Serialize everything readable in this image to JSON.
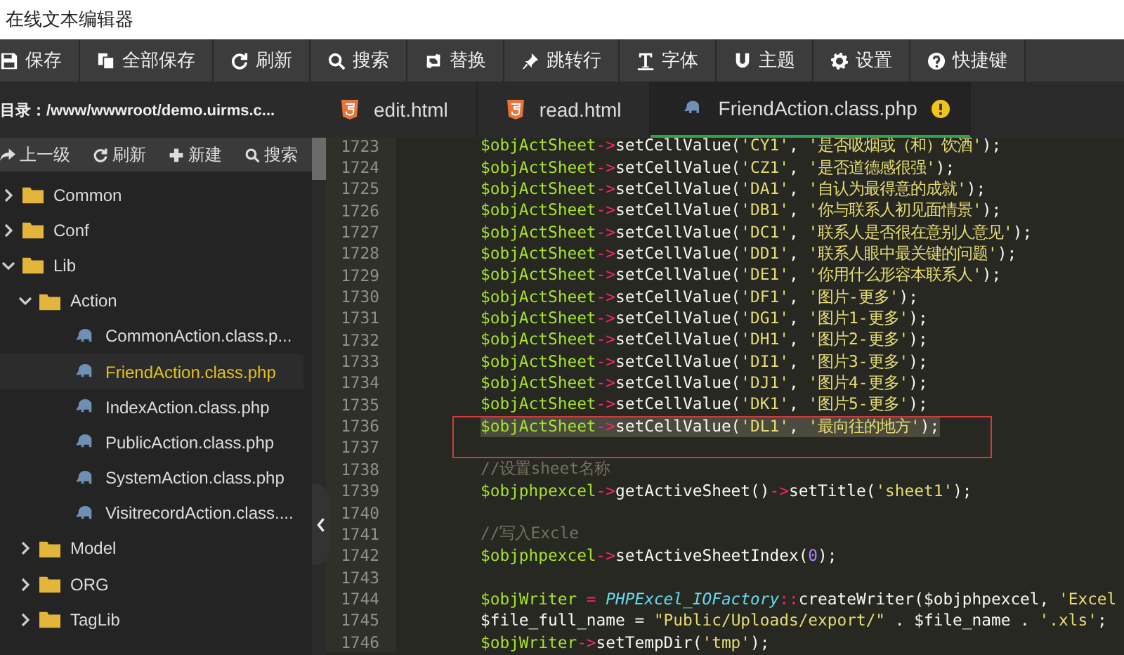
{
  "window": {
    "title": "在线文本编辑器"
  },
  "toolbar": [
    {
      "label": "保存"
    },
    {
      "label": "全部保存"
    },
    {
      "label": "刷新"
    },
    {
      "label": "搜索"
    },
    {
      "label": "替换"
    },
    {
      "label": "跳转行"
    },
    {
      "label": "字体"
    },
    {
      "label": "主题"
    },
    {
      "label": "设置"
    },
    {
      "label": "快捷键"
    }
  ],
  "sidebar": {
    "path": "目录：/www/wwwroot/demo.uirms.c...",
    "actions": [
      {
        "label": "上一级"
      },
      {
        "label": "刷新"
      },
      {
        "label": "新建"
      },
      {
        "label": "搜索"
      }
    ],
    "tree": [
      {
        "name": "Common",
        "kind": "folder",
        "expanded": false
      },
      {
        "name": "Conf",
        "kind": "folder",
        "expanded": false
      },
      {
        "name": "Lib",
        "kind": "folder",
        "expanded": true,
        "children": [
          {
            "name": "Action",
            "kind": "folder",
            "expanded": true,
            "children": [
              {
                "name": "CommonAction.class.p...",
                "kind": "file",
                "selected": false
              },
              {
                "name": "FriendAction.class.php",
                "kind": "file",
                "selected": true
              },
              {
                "name": "IndexAction.class.php",
                "kind": "file",
                "selected": false
              },
              {
                "name": "PublicAction.class.php",
                "kind": "file",
                "selected": false
              },
              {
                "name": "SystemAction.class.php",
                "kind": "file",
                "selected": false
              },
              {
                "name": "VisitrecordAction.class....",
                "kind": "file",
                "selected": false
              }
            ]
          },
          {
            "name": "Model",
            "kind": "folder",
            "expanded": false
          },
          {
            "name": "ORG",
            "kind": "folder",
            "expanded": false
          },
          {
            "name": "TagLib",
            "kind": "folder",
            "expanded": false
          }
        ]
      }
    ]
  },
  "tabs": [
    {
      "label": "edit.html",
      "kind": "html",
      "selected": false,
      "warning": false
    },
    {
      "label": "read.html",
      "kind": "html",
      "selected": false,
      "warning": false
    },
    {
      "label": "FriendAction.class.php",
      "kind": "php",
      "selected": true,
      "warning": true
    }
  ],
  "editor": {
    "lines": [
      {
        "number": "1723",
        "tokens": [
          {
            "kind": "var",
            "text": "$objActSheet"
          },
          {
            "kind": "op",
            "text": "->"
          },
          {
            "kind": "fn",
            "text": "setCellValue("
          },
          {
            "kind": "str",
            "text": "'CY1'"
          },
          {
            "kind": "fn",
            "text": ", "
          },
          {
            "kind": "str",
            "text": "'是否吸烟或（和）饮酒'"
          },
          {
            "kind": "fn",
            "text": ");"
          }
        ]
      },
      {
        "number": "1724",
        "tokens": [
          {
            "kind": "var",
            "text": "$objActSheet"
          },
          {
            "kind": "op",
            "text": "->"
          },
          {
            "kind": "fn",
            "text": "setCellValue("
          },
          {
            "kind": "str",
            "text": "'CZ1'"
          },
          {
            "kind": "fn",
            "text": ", "
          },
          {
            "kind": "str",
            "text": "'是否道德感很强'"
          },
          {
            "kind": "fn",
            "text": ");"
          }
        ]
      },
      {
        "number": "1725",
        "tokens": [
          {
            "kind": "var",
            "text": "$objActSheet"
          },
          {
            "kind": "op",
            "text": "->"
          },
          {
            "kind": "fn",
            "text": "setCellValue("
          },
          {
            "kind": "str",
            "text": "'DA1'"
          },
          {
            "kind": "fn",
            "text": ", "
          },
          {
            "kind": "str",
            "text": "'自认为最得意的成就'"
          },
          {
            "kind": "fn",
            "text": ");"
          }
        ]
      },
      {
        "number": "1726",
        "tokens": [
          {
            "kind": "var",
            "text": "$objActSheet"
          },
          {
            "kind": "op",
            "text": "->"
          },
          {
            "kind": "fn",
            "text": "setCellValue("
          },
          {
            "kind": "str",
            "text": "'DB1'"
          },
          {
            "kind": "fn",
            "text": ", "
          },
          {
            "kind": "str",
            "text": "'你与联系人初见面情景'"
          },
          {
            "kind": "fn",
            "text": ");"
          }
        ]
      },
      {
        "number": "1727",
        "tokens": [
          {
            "kind": "var",
            "text": "$objActSheet"
          },
          {
            "kind": "op",
            "text": "->"
          },
          {
            "kind": "fn",
            "text": "setCellValue("
          },
          {
            "kind": "str",
            "text": "'DC1'"
          },
          {
            "kind": "fn",
            "text": ", "
          },
          {
            "kind": "str",
            "text": "'联系人是否很在意别人意见'"
          },
          {
            "kind": "fn",
            "text": ");"
          }
        ]
      },
      {
        "number": "1728",
        "tokens": [
          {
            "kind": "var",
            "text": "$objActSheet"
          },
          {
            "kind": "op",
            "text": "->"
          },
          {
            "kind": "fn",
            "text": "setCellValue("
          },
          {
            "kind": "str",
            "text": "'DD1'"
          },
          {
            "kind": "fn",
            "text": ", "
          },
          {
            "kind": "str",
            "text": "'联系人眼中最关键的问题'"
          },
          {
            "kind": "fn",
            "text": ");"
          }
        ]
      },
      {
        "number": "1729",
        "tokens": [
          {
            "kind": "var",
            "text": "$objActSheet"
          },
          {
            "kind": "op",
            "text": "->"
          },
          {
            "kind": "fn",
            "text": "setCellValue("
          },
          {
            "kind": "str",
            "text": "'DE1'"
          },
          {
            "kind": "fn",
            "text": ", "
          },
          {
            "kind": "str",
            "text": "'你用什么形容本联系人'"
          },
          {
            "kind": "fn",
            "text": ");"
          }
        ]
      },
      {
        "number": "1730",
        "tokens": [
          {
            "kind": "var",
            "text": "$objActSheet"
          },
          {
            "kind": "op",
            "text": "->"
          },
          {
            "kind": "fn",
            "text": "setCellValue("
          },
          {
            "kind": "str",
            "text": "'DF1'"
          },
          {
            "kind": "fn",
            "text": ", "
          },
          {
            "kind": "str",
            "text": "'图片-更多'"
          },
          {
            "kind": "fn",
            "text": ");"
          }
        ]
      },
      {
        "number": "1731",
        "tokens": [
          {
            "kind": "var",
            "text": "$objActSheet"
          },
          {
            "kind": "op",
            "text": "->"
          },
          {
            "kind": "fn",
            "text": "setCellValue("
          },
          {
            "kind": "str",
            "text": "'DG1'"
          },
          {
            "kind": "fn",
            "text": ", "
          },
          {
            "kind": "str",
            "text": "'图片1-更多'"
          },
          {
            "kind": "fn",
            "text": ");"
          }
        ]
      },
      {
        "number": "1732",
        "tokens": [
          {
            "kind": "var",
            "text": "$objActSheet"
          },
          {
            "kind": "op",
            "text": "->"
          },
          {
            "kind": "fn",
            "text": "setCellValue("
          },
          {
            "kind": "str",
            "text": "'DH1'"
          },
          {
            "kind": "fn",
            "text": ", "
          },
          {
            "kind": "str",
            "text": "'图片2-更多'"
          },
          {
            "kind": "fn",
            "text": ");"
          }
        ]
      },
      {
        "number": "1733",
        "tokens": [
          {
            "kind": "var",
            "text": "$objActSheet"
          },
          {
            "kind": "op",
            "text": "->"
          },
          {
            "kind": "fn",
            "text": "setCellValue("
          },
          {
            "kind": "str",
            "text": "'DI1'"
          },
          {
            "kind": "fn",
            "text": ", "
          },
          {
            "kind": "str",
            "text": "'图片3-更多'"
          },
          {
            "kind": "fn",
            "text": ");"
          }
        ]
      },
      {
        "number": "1734",
        "tokens": [
          {
            "kind": "var",
            "text": "$objActSheet"
          },
          {
            "kind": "op",
            "text": "->"
          },
          {
            "kind": "fn",
            "text": "setCellValue("
          },
          {
            "kind": "str",
            "text": "'DJ1'"
          },
          {
            "kind": "fn",
            "text": ", "
          },
          {
            "kind": "str",
            "text": "'图片4-更多'"
          },
          {
            "kind": "fn",
            "text": ");"
          }
        ]
      },
      {
        "number": "1735",
        "tokens": [
          {
            "kind": "var",
            "text": "$objActSheet"
          },
          {
            "kind": "op",
            "text": "->"
          },
          {
            "kind": "fn",
            "text": "setCellValue("
          },
          {
            "kind": "str",
            "text": "'DK1'"
          },
          {
            "kind": "fn",
            "text": ", "
          },
          {
            "kind": "str",
            "text": "'图片5-更多'"
          },
          {
            "kind": "fn",
            "text": ");"
          }
        ]
      },
      {
        "number": "1736",
        "selected": true,
        "boxed": true,
        "tokens": [
          {
            "kind": "var",
            "text": "$objActSheet"
          },
          {
            "kind": "op",
            "text": "->"
          },
          {
            "kind": "fn",
            "text": "setCellValue("
          },
          {
            "kind": "str",
            "text": "'DL1'"
          },
          {
            "kind": "fn",
            "text": ", "
          },
          {
            "kind": "str",
            "text": "'最向往的地方'"
          },
          {
            "kind": "fn",
            "text": ");"
          }
        ]
      },
      {
        "number": "1737",
        "boxed": true
      },
      {
        "number": "1738",
        "tokens": [
          {
            "kind": "comment",
            "text": "//设置sheet名称"
          }
        ]
      },
      {
        "number": "1739",
        "tokens": [
          {
            "kind": "var",
            "text": "$objphpexcel"
          },
          {
            "kind": "op",
            "text": "->"
          },
          {
            "kind": "fn",
            "text": "getActiveSheet()"
          },
          {
            "kind": "op",
            "text": "->"
          },
          {
            "kind": "fn",
            "text": "setTitle("
          },
          {
            "kind": "str",
            "text": "'sheet1'"
          },
          {
            "kind": "fn",
            "text": ");"
          }
        ]
      },
      {
        "number": "1740"
      },
      {
        "number": "1741",
        "tokens": [
          {
            "kind": "comment",
            "text": "//写入Excle"
          }
        ]
      },
      {
        "number": "1742",
        "tokens": [
          {
            "kind": "var",
            "text": "$objphpexcel"
          },
          {
            "kind": "op",
            "text": "->"
          },
          {
            "kind": "fn",
            "text": "setActiveSheetIndex("
          },
          {
            "kind": "num",
            "text": "0"
          },
          {
            "kind": "fn",
            "text": ");"
          }
        ]
      },
      {
        "number": "1743"
      },
      {
        "number": "1744",
        "tokens": [
          {
            "kind": "var",
            "text": "$objWriter"
          },
          {
            "kind": "op",
            "text": " = "
          },
          {
            "kind": "class",
            "text": "PHPExcel_IOFactory"
          },
          {
            "kind": "op",
            "text": "::"
          },
          {
            "kind": "fn",
            "text": "createWriter("
          },
          {
            "kind": "plain",
            "text": "$objphpexcel"
          },
          {
            "kind": "fn",
            "text": ", "
          },
          {
            "kind": "str",
            "text": "'Excel"
          }
        ]
      },
      {
        "number": "1745",
        "tokens": [
          {
            "kind": "plain",
            "text": "$file_full_name"
          },
          {
            "kind": "fn",
            "text": " = "
          },
          {
            "kind": "str",
            "text": "\"Public/Uploads/export/\""
          },
          {
            "kind": "fn",
            "text": " . "
          },
          {
            "kind": "plain",
            "text": "$file_name"
          },
          {
            "kind": "fn",
            "text": " . "
          },
          {
            "kind": "str",
            "text": "'.xls'"
          },
          {
            "kind": "fn",
            "text": ";"
          }
        ]
      },
      {
        "number": "1746",
        "tokens": [
          {
            "kind": "var",
            "text": "$objWriter"
          },
          {
            "kind": "op",
            "text": "->"
          },
          {
            "kind": "fn",
            "text": "setTempDir("
          },
          {
            "kind": "str",
            "text": "'tmp'"
          },
          {
            "kind": "fn",
            "text": ");"
          }
        ]
      }
    ]
  }
}
